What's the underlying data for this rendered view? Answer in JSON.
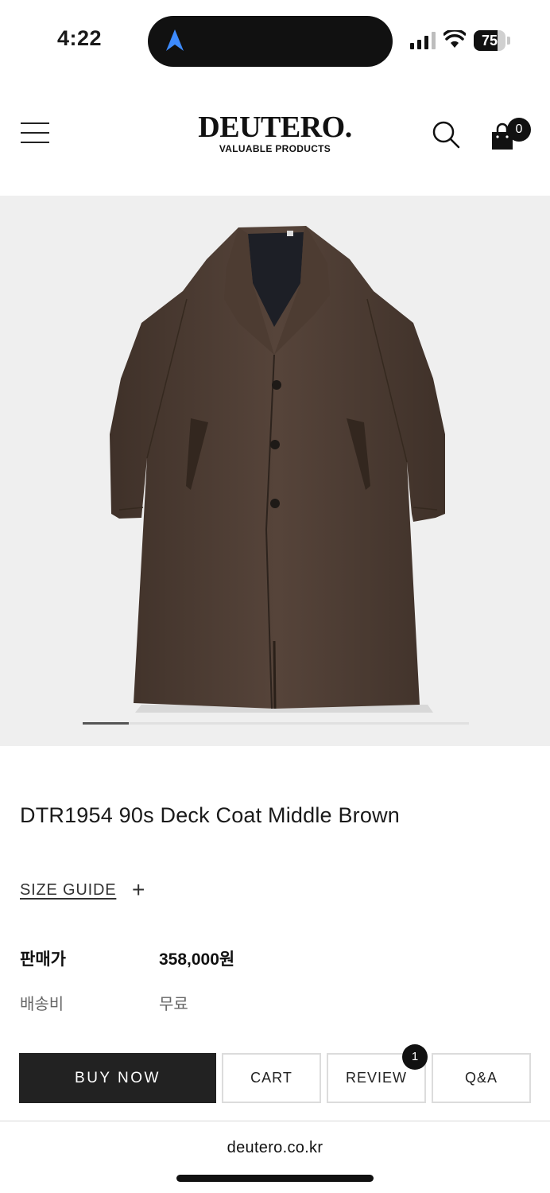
{
  "status_bar": {
    "time": "4:22",
    "battery": "75",
    "battery_level": 0.75
  },
  "header": {
    "logo": "DEUTERO.",
    "logo_tagline": "VALUABLE PRODUCTS",
    "cart_count": "0"
  },
  "gallery": {
    "slide_progress": 0.12
  },
  "product": {
    "title": "DTR1954 90s Deck Coat Middle Brown",
    "size_guide": "SIZE GUIDE",
    "size_guide_toggle": "+",
    "price_label": "판매가",
    "price_value": "358,000원",
    "shipping_label": "배송비",
    "shipping_value": "무료"
  },
  "actions": {
    "buy_now": "BUY NOW",
    "cart": "CART",
    "review": "REVIEW",
    "review_count": "1",
    "qa": "Q&A"
  },
  "browser": {
    "url": "deutero.co.kr"
  },
  "colors": {
    "primary_button": "#222222",
    "page_background": "#ffffff",
    "gallery_background": "#efefef",
    "coat_brown": "#4a3a30"
  }
}
